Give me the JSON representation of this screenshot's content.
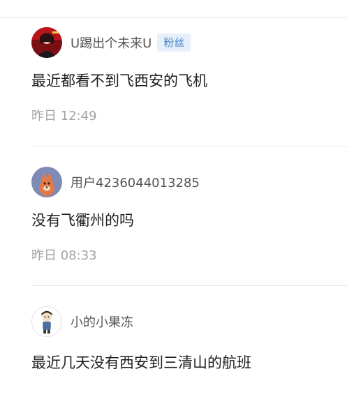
{
  "comments": [
    {
      "username": "U踢出个未来U",
      "badge": "粉丝",
      "text": "最近都看不到飞西安的飞机",
      "time": "昨日 12:49"
    },
    {
      "username": "用户4236044013285",
      "text": "没有飞衢州的吗",
      "time": "昨日 08:33"
    },
    {
      "username": "小的小果冻",
      "text": "最近几天没有西安到三清山的航班"
    }
  ],
  "colors": {
    "badge_bg": "#e6f0fb",
    "badge_text": "#4a86c8",
    "time_text": "#a3a3a3",
    "divider": "#e6e6e6"
  }
}
